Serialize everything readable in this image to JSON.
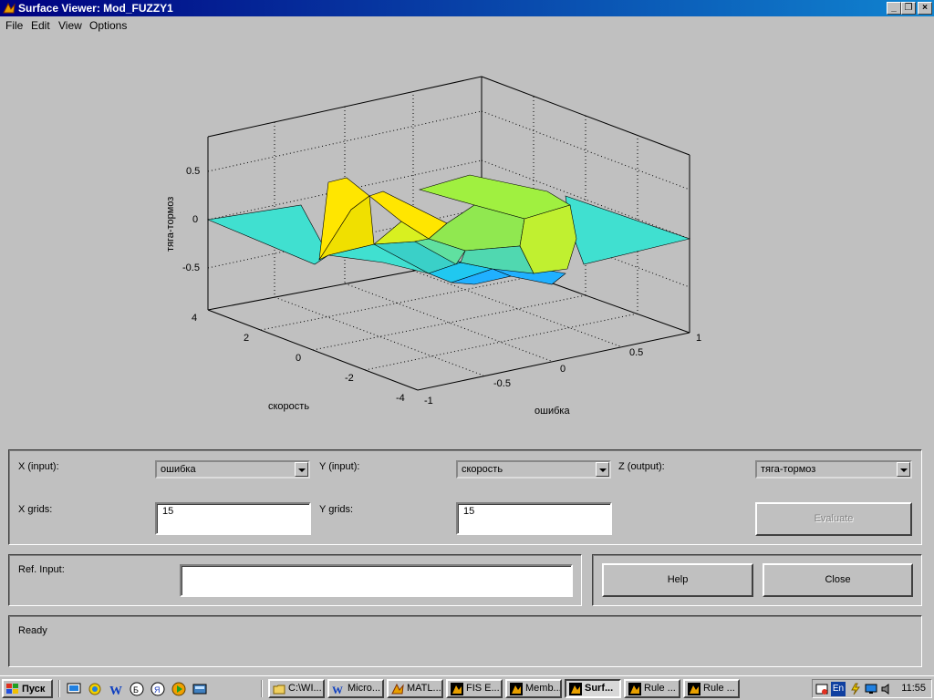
{
  "window": {
    "title": "Surface Viewer: Mod_FUZZY1"
  },
  "menu": {
    "items": [
      "File",
      "Edit",
      "View",
      "Options"
    ]
  },
  "plot": {
    "zlabel": "тяга-тормоз",
    "xlabel": "ошибка",
    "ylabel": "скорость",
    "z_ticks": [
      "0.5",
      "0",
      "-0.5"
    ],
    "x_ticks": [
      "-1",
      "-0.5",
      "0",
      "0.5",
      "1"
    ],
    "y_ticks": [
      "-4",
      "-2",
      "0",
      "2",
      "4"
    ]
  },
  "chart_data": {
    "type": "surface",
    "xlabel": "ошибка",
    "ylabel": "скорость",
    "zlabel": "тяга-тормоз",
    "xlim": [
      -1,
      1
    ],
    "ylim": [
      -4,
      4
    ],
    "zlim": [
      -0.8,
      0.8
    ],
    "grid": true
  },
  "controls": {
    "x_input_label": "X (input):",
    "x_input_value": "ошибка",
    "y_input_label": "Y (input):",
    "y_input_value": "скорость",
    "z_output_label": "Z (output):",
    "z_output_value": "тяга-тормоз",
    "x_grids_label": "X grids:",
    "x_grids_value": "15",
    "y_grids_label": "Y grids:",
    "y_grids_value": "15",
    "evaluate_label": "Evaluate",
    "ref_input_label": "Ref. Input:",
    "ref_input_value": "",
    "help_label": "Help",
    "close_label": "Close"
  },
  "status": {
    "text": "Ready"
  },
  "taskbar": {
    "start_label": "Пуск",
    "tasks": [
      "C:\\WI...",
      "Micro...",
      "MATL...",
      "FIS E...",
      "Memb...",
      "Surf...",
      "Rule ...",
      "Rule ..."
    ],
    "clock": "11:55",
    "lang": "En"
  },
  "colors": {
    "titlebar": "#000080",
    "surface_cyan": "#40e0d0",
    "surface_yellow": "#ffe600",
    "surface_green": "#a0f040",
    "surface_blue": "#20b0ff"
  }
}
